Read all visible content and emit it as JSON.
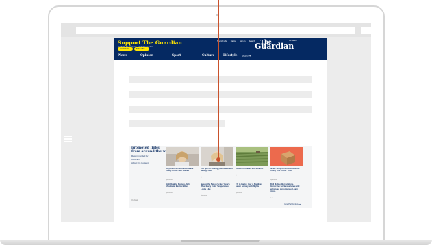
{
  "header": {
    "support_title": "Support The Guardian",
    "support_sub": "Available for everyone, funded by readers",
    "contribute_label": "Contribute →",
    "subscribe_label": "Subscribe →",
    "top_links": [
      "Search jobs",
      "Dating",
      "Sign in",
      "Search"
    ],
    "edition": "UK edition",
    "logo_the": "The",
    "logo_guardian": "Guardian",
    "brand_color": "#052962",
    "accent_color": "#ffe500"
  },
  "nav": {
    "items": [
      "News",
      "Opinion",
      "Sport",
      "Culture",
      "Lifestyle"
    ],
    "more": "More ▾"
  },
  "promo": {
    "title_line1": "promoted links",
    "title_line2": "from around the web",
    "recommended": "Recommended by",
    "provider": "Outbrain",
    "about": "About this Content",
    "cards": [
      {
        "title": "Why Over-50s Should Release Equity From Their Homes",
        "source": "Sponsored",
        "more_title": "High Quality, Feature-Rich, Affordable Electric Bikes",
        "more_source": "Sponsored"
      },
      {
        "title": "Top tips on making your retirement savings last",
        "source": "Sponsored",
        "more_title": "New to the Nation Scale? Here's What Every Color Temperature Looks Like",
        "more_source": "Sponsored"
      },
      {
        "title": "12 must-do hikes this Summer",
        "source": "Sponsored",
        "more_title": "Fly to Lanka: tour & Maldives beach holiday with flights",
        "more_source": "Sponsored"
      },
      {
        "title": "Never Shop on Amazon Without Using This Clever Trick",
        "source": "Sponsored",
        "more_title": "Dell Mobile Workstations. Immersive work experience and enhanced performance. Learn more.",
        "more_source": "Dell"
      }
    ],
    "footer_left": "Outbrain",
    "footer_right": "View Part Content ▸▸"
  }
}
